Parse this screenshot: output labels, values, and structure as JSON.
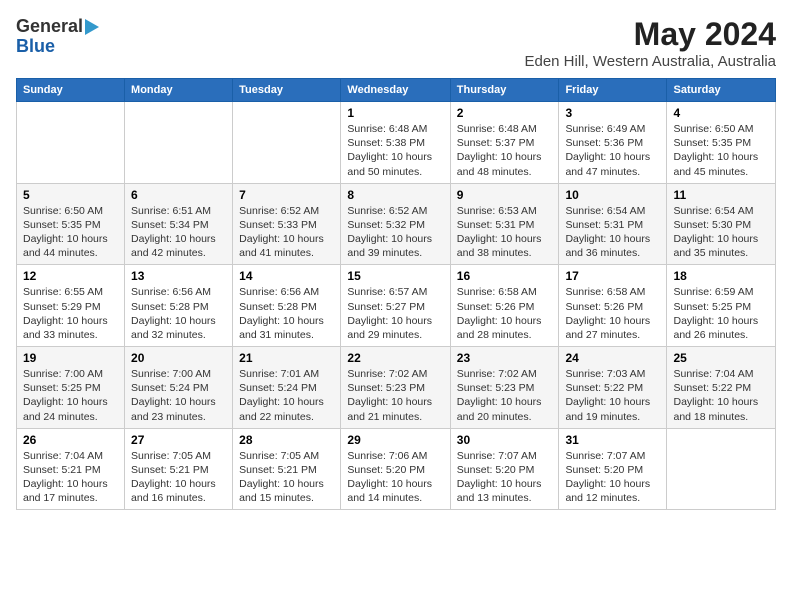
{
  "logo": {
    "line1": "General",
    "line2": "Blue"
  },
  "title": "May 2024",
  "subtitle": "Eden Hill, Western Australia, Australia",
  "days_of_week": [
    "Sunday",
    "Monday",
    "Tuesday",
    "Wednesday",
    "Thursday",
    "Friday",
    "Saturday"
  ],
  "weeks": [
    [
      {
        "day": "",
        "info": ""
      },
      {
        "day": "",
        "info": ""
      },
      {
        "day": "",
        "info": ""
      },
      {
        "day": "1",
        "info": "Sunrise: 6:48 AM\nSunset: 5:38 PM\nDaylight: 10 hours and 50 minutes."
      },
      {
        "day": "2",
        "info": "Sunrise: 6:48 AM\nSunset: 5:37 PM\nDaylight: 10 hours and 48 minutes."
      },
      {
        "day": "3",
        "info": "Sunrise: 6:49 AM\nSunset: 5:36 PM\nDaylight: 10 hours and 47 minutes."
      },
      {
        "day": "4",
        "info": "Sunrise: 6:50 AM\nSunset: 5:35 PM\nDaylight: 10 hours and 45 minutes."
      }
    ],
    [
      {
        "day": "5",
        "info": "Sunrise: 6:50 AM\nSunset: 5:35 PM\nDaylight: 10 hours and 44 minutes."
      },
      {
        "day": "6",
        "info": "Sunrise: 6:51 AM\nSunset: 5:34 PM\nDaylight: 10 hours and 42 minutes."
      },
      {
        "day": "7",
        "info": "Sunrise: 6:52 AM\nSunset: 5:33 PM\nDaylight: 10 hours and 41 minutes."
      },
      {
        "day": "8",
        "info": "Sunrise: 6:52 AM\nSunset: 5:32 PM\nDaylight: 10 hours and 39 minutes."
      },
      {
        "day": "9",
        "info": "Sunrise: 6:53 AM\nSunset: 5:31 PM\nDaylight: 10 hours and 38 minutes."
      },
      {
        "day": "10",
        "info": "Sunrise: 6:54 AM\nSunset: 5:31 PM\nDaylight: 10 hours and 36 minutes."
      },
      {
        "day": "11",
        "info": "Sunrise: 6:54 AM\nSunset: 5:30 PM\nDaylight: 10 hours and 35 minutes."
      }
    ],
    [
      {
        "day": "12",
        "info": "Sunrise: 6:55 AM\nSunset: 5:29 PM\nDaylight: 10 hours and 33 minutes."
      },
      {
        "day": "13",
        "info": "Sunrise: 6:56 AM\nSunset: 5:28 PM\nDaylight: 10 hours and 32 minutes."
      },
      {
        "day": "14",
        "info": "Sunrise: 6:56 AM\nSunset: 5:28 PM\nDaylight: 10 hours and 31 minutes."
      },
      {
        "day": "15",
        "info": "Sunrise: 6:57 AM\nSunset: 5:27 PM\nDaylight: 10 hours and 29 minutes."
      },
      {
        "day": "16",
        "info": "Sunrise: 6:58 AM\nSunset: 5:26 PM\nDaylight: 10 hours and 28 minutes."
      },
      {
        "day": "17",
        "info": "Sunrise: 6:58 AM\nSunset: 5:26 PM\nDaylight: 10 hours and 27 minutes."
      },
      {
        "day": "18",
        "info": "Sunrise: 6:59 AM\nSunset: 5:25 PM\nDaylight: 10 hours and 26 minutes."
      }
    ],
    [
      {
        "day": "19",
        "info": "Sunrise: 7:00 AM\nSunset: 5:25 PM\nDaylight: 10 hours and 24 minutes."
      },
      {
        "day": "20",
        "info": "Sunrise: 7:00 AM\nSunset: 5:24 PM\nDaylight: 10 hours and 23 minutes."
      },
      {
        "day": "21",
        "info": "Sunrise: 7:01 AM\nSunset: 5:24 PM\nDaylight: 10 hours and 22 minutes."
      },
      {
        "day": "22",
        "info": "Sunrise: 7:02 AM\nSunset: 5:23 PM\nDaylight: 10 hours and 21 minutes."
      },
      {
        "day": "23",
        "info": "Sunrise: 7:02 AM\nSunset: 5:23 PM\nDaylight: 10 hours and 20 minutes."
      },
      {
        "day": "24",
        "info": "Sunrise: 7:03 AM\nSunset: 5:22 PM\nDaylight: 10 hours and 19 minutes."
      },
      {
        "day": "25",
        "info": "Sunrise: 7:04 AM\nSunset: 5:22 PM\nDaylight: 10 hours and 18 minutes."
      }
    ],
    [
      {
        "day": "26",
        "info": "Sunrise: 7:04 AM\nSunset: 5:21 PM\nDaylight: 10 hours and 17 minutes."
      },
      {
        "day": "27",
        "info": "Sunrise: 7:05 AM\nSunset: 5:21 PM\nDaylight: 10 hours and 16 minutes."
      },
      {
        "day": "28",
        "info": "Sunrise: 7:05 AM\nSunset: 5:21 PM\nDaylight: 10 hours and 15 minutes."
      },
      {
        "day": "29",
        "info": "Sunrise: 7:06 AM\nSunset: 5:20 PM\nDaylight: 10 hours and 14 minutes."
      },
      {
        "day": "30",
        "info": "Sunrise: 7:07 AM\nSunset: 5:20 PM\nDaylight: 10 hours and 13 minutes."
      },
      {
        "day": "31",
        "info": "Sunrise: 7:07 AM\nSunset: 5:20 PM\nDaylight: 10 hours and 12 minutes."
      },
      {
        "day": "",
        "info": ""
      }
    ]
  ]
}
